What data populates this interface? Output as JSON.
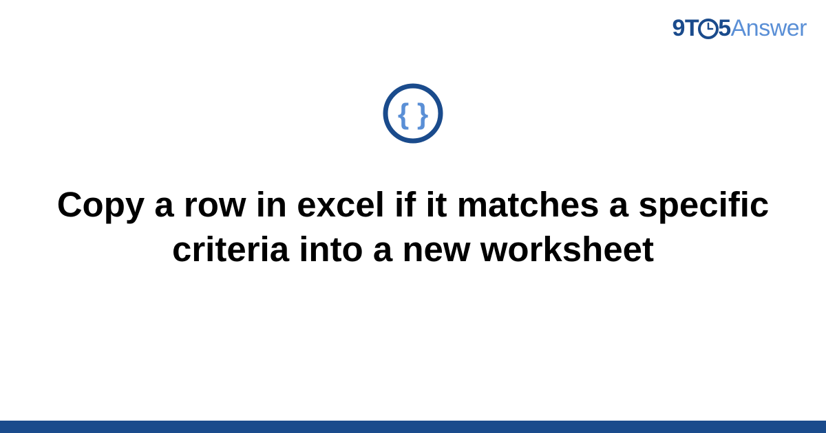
{
  "brand": {
    "part1": "9T",
    "part2": "5",
    "part3": "Answer"
  },
  "title": "Copy a row in excel if it matches a specific criteria into a new worksheet",
  "colors": {
    "brand_dark": "#1a4b8c",
    "brand_light": "#5a8fd6",
    "footer": "#1a4b8c"
  }
}
